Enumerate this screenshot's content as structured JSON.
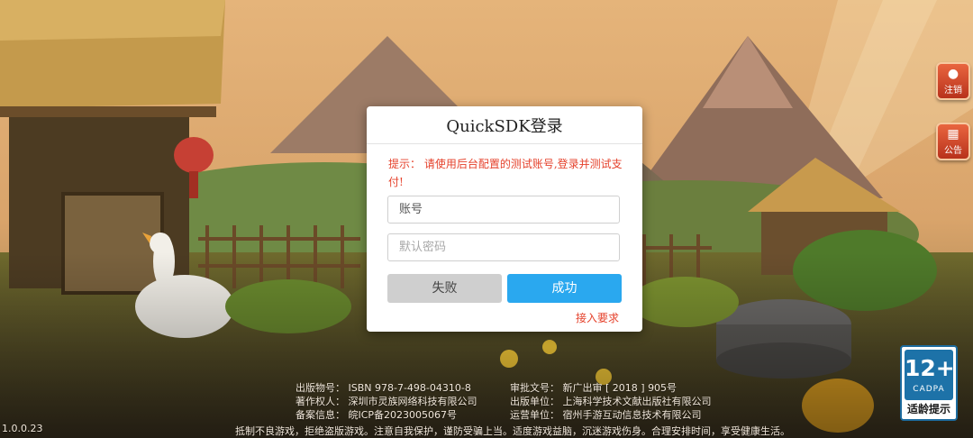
{
  "side_buttons": {
    "logout": {
      "label": "注销",
      "icon": "person-icon"
    },
    "notice": {
      "label": "公告",
      "icon": "document-icon"
    }
  },
  "dialog": {
    "title": "QuickSDK登录",
    "hint": "提示： 请使用后台配置的测试账号,登录并测试支付!",
    "account_placeholder": "账号",
    "password_placeholder": "默认密码",
    "fail_label": "失败",
    "success_label": "成功",
    "extra_link": "接入要求"
  },
  "publication_info": {
    "left": [
      {
        "label": "出版物号：",
        "value": "ISBN 978-7-498-04310-8"
      },
      {
        "label": "著作权人：",
        "value": "深圳市灵族网络科技有限公司"
      },
      {
        "label": "备案信息：",
        "value": "皖ICP备2023005067号"
      }
    ],
    "right": [
      {
        "label": "审批文号：",
        "value": "新广出审 [ 2018 ] 905号"
      },
      {
        "label": "出版单位：",
        "value": "上海科学技术文献出版社有限公司"
      },
      {
        "label": "运营单位：",
        "value": "宿州手游互动信息技术有限公司"
      }
    ]
  },
  "health_notice": "抵制不良游戏，拒绝盗版游戏。注意自我保护，谨防受骗上当。适度游戏益脑，沉迷游戏伤身。合理安排时间，享受健康生活。",
  "version": "1.0.0.23",
  "age_rating": {
    "number": "12+",
    "org": "CADPA",
    "label": "适龄提示"
  }
}
